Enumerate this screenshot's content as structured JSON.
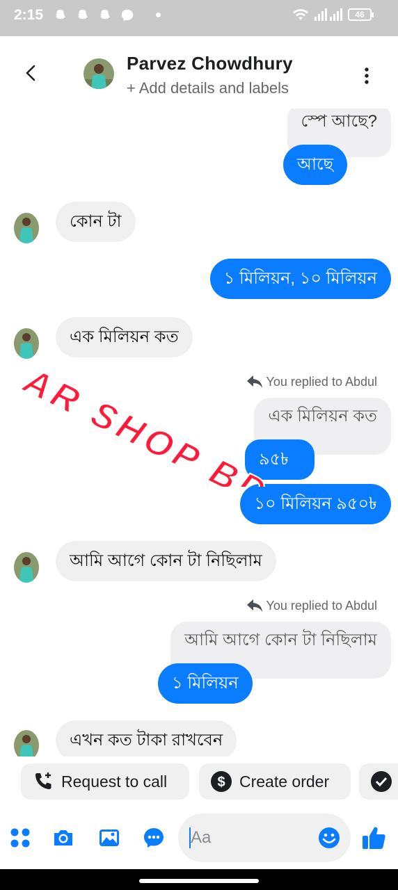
{
  "status_bar": {
    "time": "2:15",
    "battery": "46"
  },
  "header": {
    "contact_name": "Parvez Chowdhury",
    "subtitle": "+ Add details and labels"
  },
  "messages": {
    "m1": "স্পে আছে?",
    "m2": "আছে",
    "m3": "কোন টা",
    "m4": "১ মিলিয়ন, ১০ মিলিয়ন",
    "m5": "এক মিলিয়ন কত",
    "reply1": "You replied to Abdul",
    "m6_quote": "এক মিলিয়ন কত",
    "m6": "৯৫৳",
    "m7": "১০ মিলিয়ন ৯৫০৳",
    "m8": "আমি আগে কোন টা নিছিলাম",
    "reply2": "You replied to Abdul",
    "m9_quote": "আমি আগে কোন টা নিছিলাম",
    "m9": "১ মিলিয়ন",
    "m10": "এখন কত টাকা রাখবেন"
  },
  "watermark": {
    "text": "AR SHOP BD"
  },
  "quick_actions": {
    "request_call": "Request to call",
    "create_order": "Create order"
  },
  "composer": {
    "placeholder": "Aa"
  },
  "colors": {
    "accent": "#0a7cff",
    "watermark_fill": "#ff1a3a"
  }
}
